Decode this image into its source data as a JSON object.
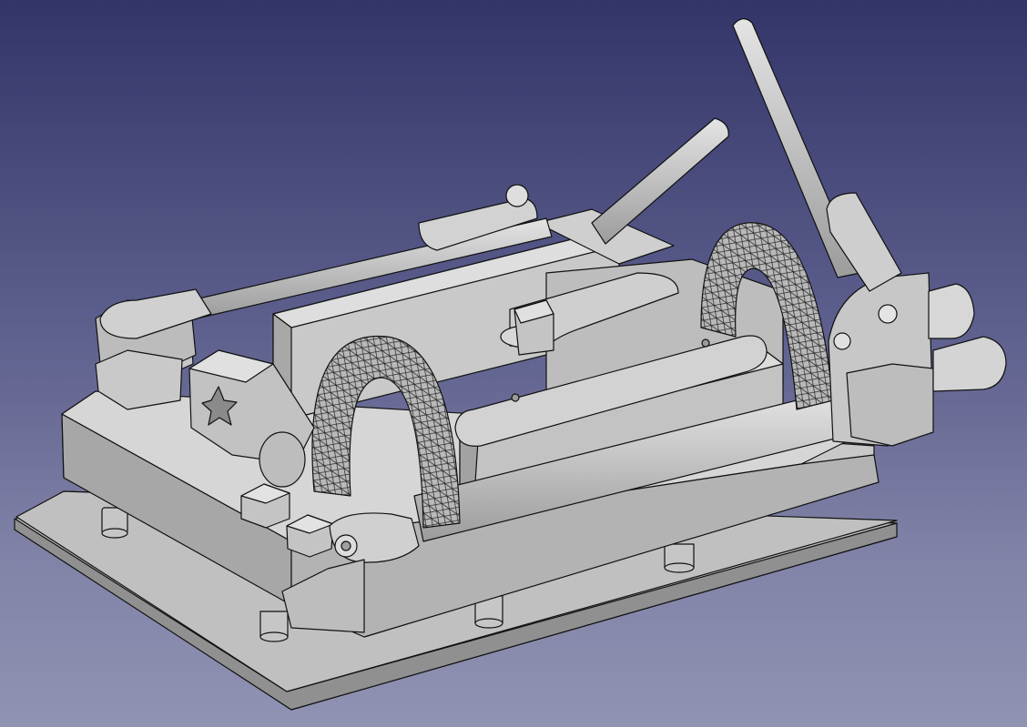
{
  "viewport": {
    "background_top": "#333569",
    "background_bottom": "#9193b3"
  },
  "model": {
    "face_color": "#c4c4c4",
    "face_light": "#dcdcdc",
    "face_dark": "#9a9a9a",
    "edge_color": "#111111"
  }
}
